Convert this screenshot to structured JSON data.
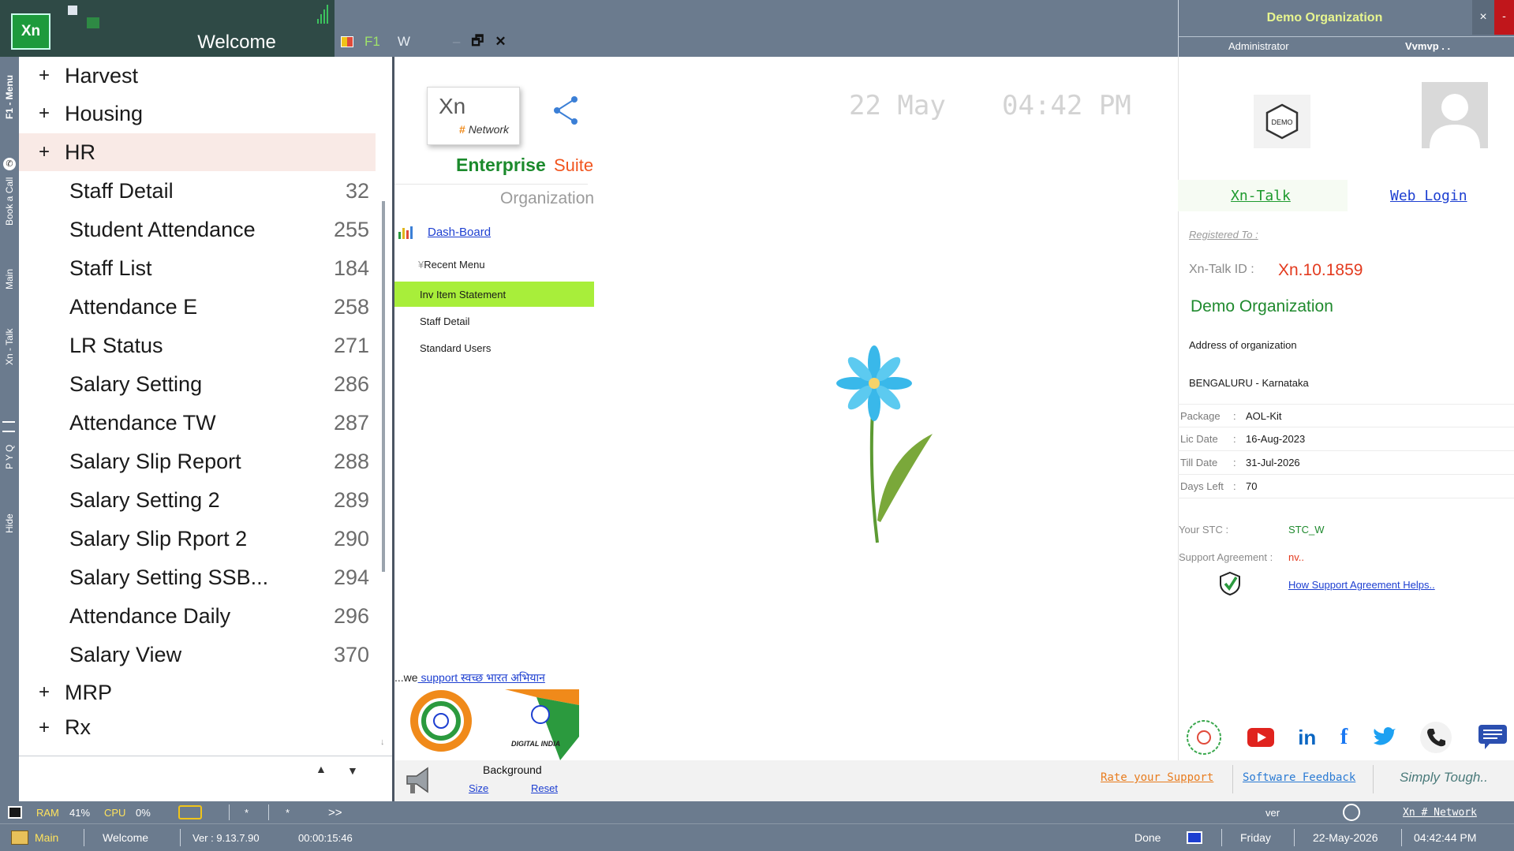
{
  "app": {
    "logo_text": "Xn",
    "welcome": "Welcome",
    "toolbar": {
      "f1": "F1",
      "w": "W",
      "minimize": "–",
      "restore": "🗗",
      "close": "✕"
    }
  },
  "org_header": {
    "org_name": "Demo Organization",
    "user": "Administrator",
    "user_short": "Vvmvp . .",
    "close_label": "×",
    "min_label": "-"
  },
  "side_tabs": [
    "F1 - Menu",
    "Book a Call",
    "Main",
    "Xn - Talk",
    "P Y Q",
    "Hide"
  ],
  "menu": {
    "groups_top": [
      {
        "label": "Harvest",
        "expander": "+"
      },
      {
        "label": "Housing",
        "expander": "+"
      },
      {
        "label": "HR",
        "expander": "+"
      }
    ],
    "hr_items": [
      {
        "label": "Staff Detail",
        "num": "32"
      },
      {
        "label": "Student Attendance",
        "num": "255"
      },
      {
        "label": "Staff List",
        "num": "184"
      },
      {
        "label": "Attendance E",
        "num": "258"
      },
      {
        "label": "LR Status",
        "num": "271"
      },
      {
        "label": "Salary Setting",
        "num": "286"
      },
      {
        "label": "Attendance TW",
        "num": "287"
      },
      {
        "label": "Salary Slip Report",
        "num": "288"
      },
      {
        "label": "Salary Setting 2",
        "num": "289"
      },
      {
        "label": "Salary Slip Rport 2",
        "num": "290"
      },
      {
        "label": "Salary Setting SSB...",
        "num": "294"
      },
      {
        "label": "Attendance Daily",
        "num": "296"
      },
      {
        "label": "Salary View",
        "num": "370"
      }
    ],
    "groups_bottom": [
      {
        "label": "MRP",
        "expander": "+"
      },
      {
        "label": "Rx",
        "expander": "+"
      }
    ]
  },
  "center": {
    "card_xn": "Xn",
    "card_hash": "#",
    "card_network": "Network",
    "enterprise": "Enterprise",
    "suite": "Suite",
    "organization": "Organization",
    "dashboard_link": "Dash-Board",
    "recent_header": "Recent Menu",
    "recent_items": [
      "Inv Item Statement",
      "Staff Detail",
      "Standard Users"
    ],
    "date": "22 May",
    "time": "04:42 PM",
    "swachh_prefix": "...we",
    "swachh_link": " support स्वच्छ भारत अभियान",
    "digital_india": "DIGITAL INDIA",
    "background_label": "Background",
    "size_link": "Size",
    "reset_link": "Reset",
    "rate_link": "Rate your Support",
    "feedback_link": "Software Feedback",
    "tagline": "Simply Tough.."
  },
  "right": {
    "demo_badge": "DEMO",
    "xn_talk_link": "Xn-Talk",
    "web_login_link": "Web Login",
    "registered_to": "Registered To :",
    "talk_id_label": "Xn-Talk ID :",
    "talk_id_value": "Xn.10.1859",
    "org_name": "Demo Organization",
    "address": "Address of organization",
    "city": "BENGALURU - Karnataka",
    "info": [
      {
        "k": "Package",
        "v": "AOL-Kit"
      },
      {
        "k": "Lic Date",
        "v": "16-Aug-2023"
      },
      {
        "k": "Till Date",
        "v": "31-Jul-2026"
      },
      {
        "k": "Days Left",
        "v": "70"
      }
    ],
    "stc_label": "Your STC :",
    "stc_value": "STC_W",
    "support_label": "Support Agreement :",
    "support_value": "nv..",
    "support_help": "How Support Agreement Helps.."
  },
  "status_top": {
    "ram_label": "RAM",
    "ram_value": "41%",
    "cpu_label": "CPU",
    "cpu_value": "0%",
    "star1": "*",
    "star2": "*",
    "more": ">>",
    "ver": "ver",
    "network": "Xn # Network"
  },
  "status_bottom": {
    "main": "Main",
    "welcome": "Welcome",
    "version": "Ver : 9.13.7.90",
    "elapsed": "00:00:15:46",
    "done": "Done",
    "day": "Friday",
    "date": "22-May-2026",
    "time": "04:42:44 PM"
  },
  "colors": {
    "accent_green": "#1b8a2c",
    "highlight": "#a8ee3a",
    "brand_orange": "#f1551f",
    "link_blue": "#1d3fd1"
  }
}
